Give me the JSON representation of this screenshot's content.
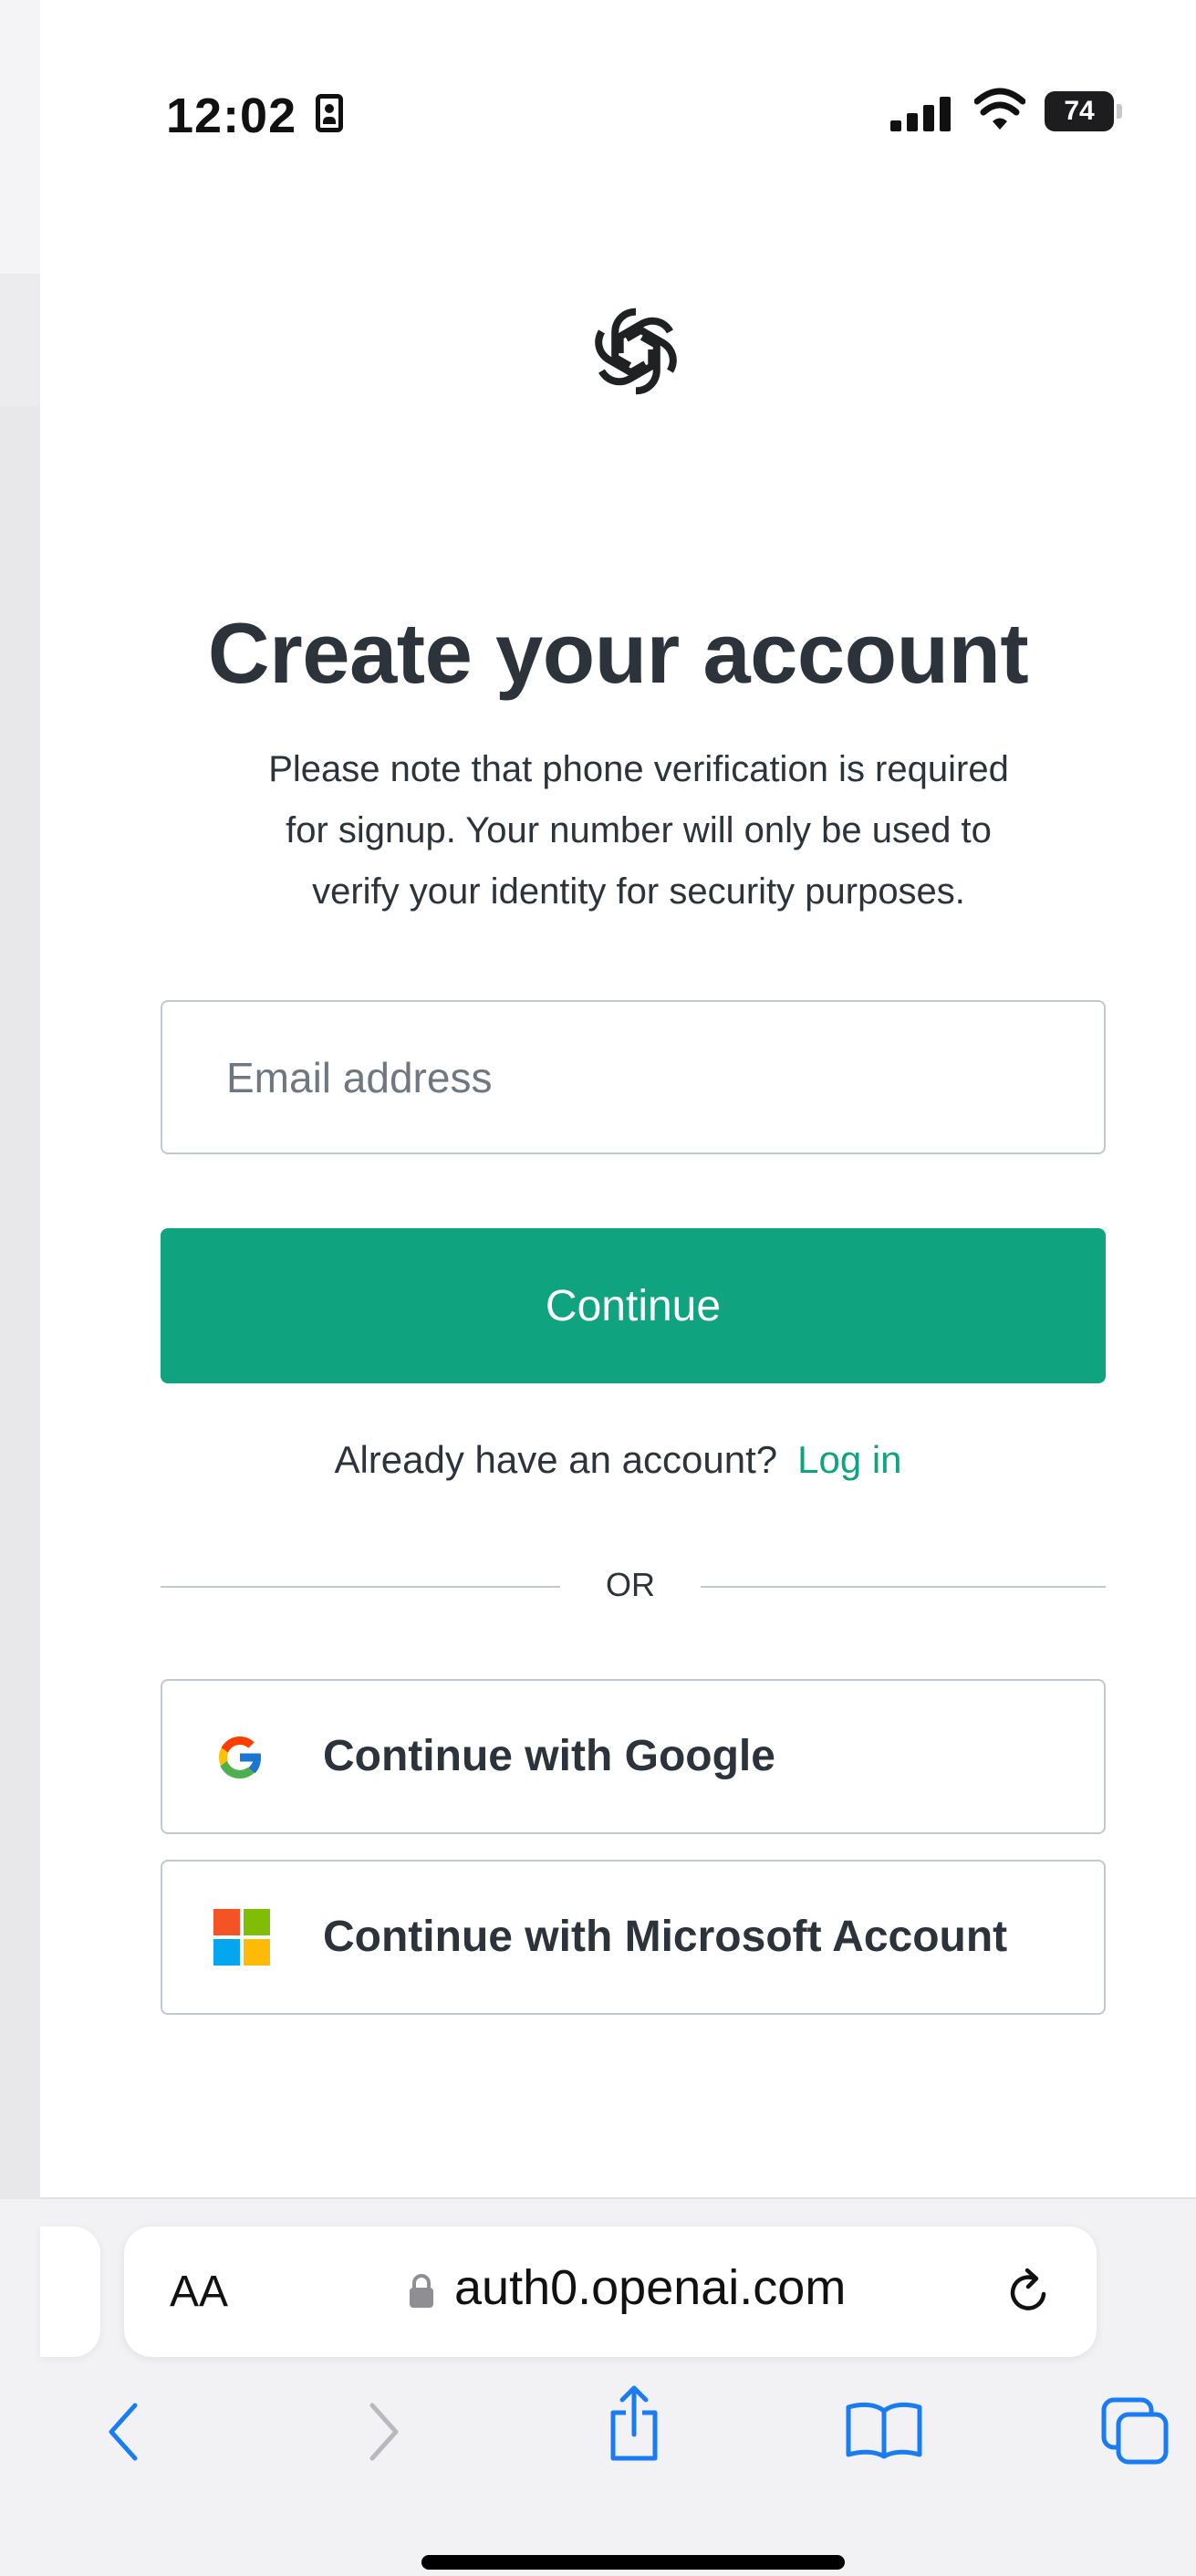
{
  "status_bar": {
    "time": "12:02",
    "battery": "74",
    "icons": [
      "contact-card-icon",
      "signal-icon",
      "wifi-icon",
      "battery-icon"
    ]
  },
  "page": {
    "logo_icon": "openai-logo-icon",
    "title": "Create your account",
    "subtitle_lines": [
      "Please note that phone verification is required",
      "for signup. Your number will only be used to",
      "verify your identity for security purposes."
    ],
    "email": {
      "value": "",
      "placeholder": "Email address"
    },
    "continue_label": "Continue",
    "login_prompt": "Already have an account?",
    "login_link": "Log in",
    "divider_text": "OR",
    "google_label": "Continue with Google",
    "microsoft_label": "Continue with Microsoft Account",
    "accent_color": "#10a37f"
  },
  "browser": {
    "text_size_label": "AA",
    "url": "auth0.openai.com",
    "toolbar_icons": [
      "back-icon",
      "forward-icon",
      "share-icon",
      "bookmarks-icon",
      "tabs-icon"
    ]
  }
}
